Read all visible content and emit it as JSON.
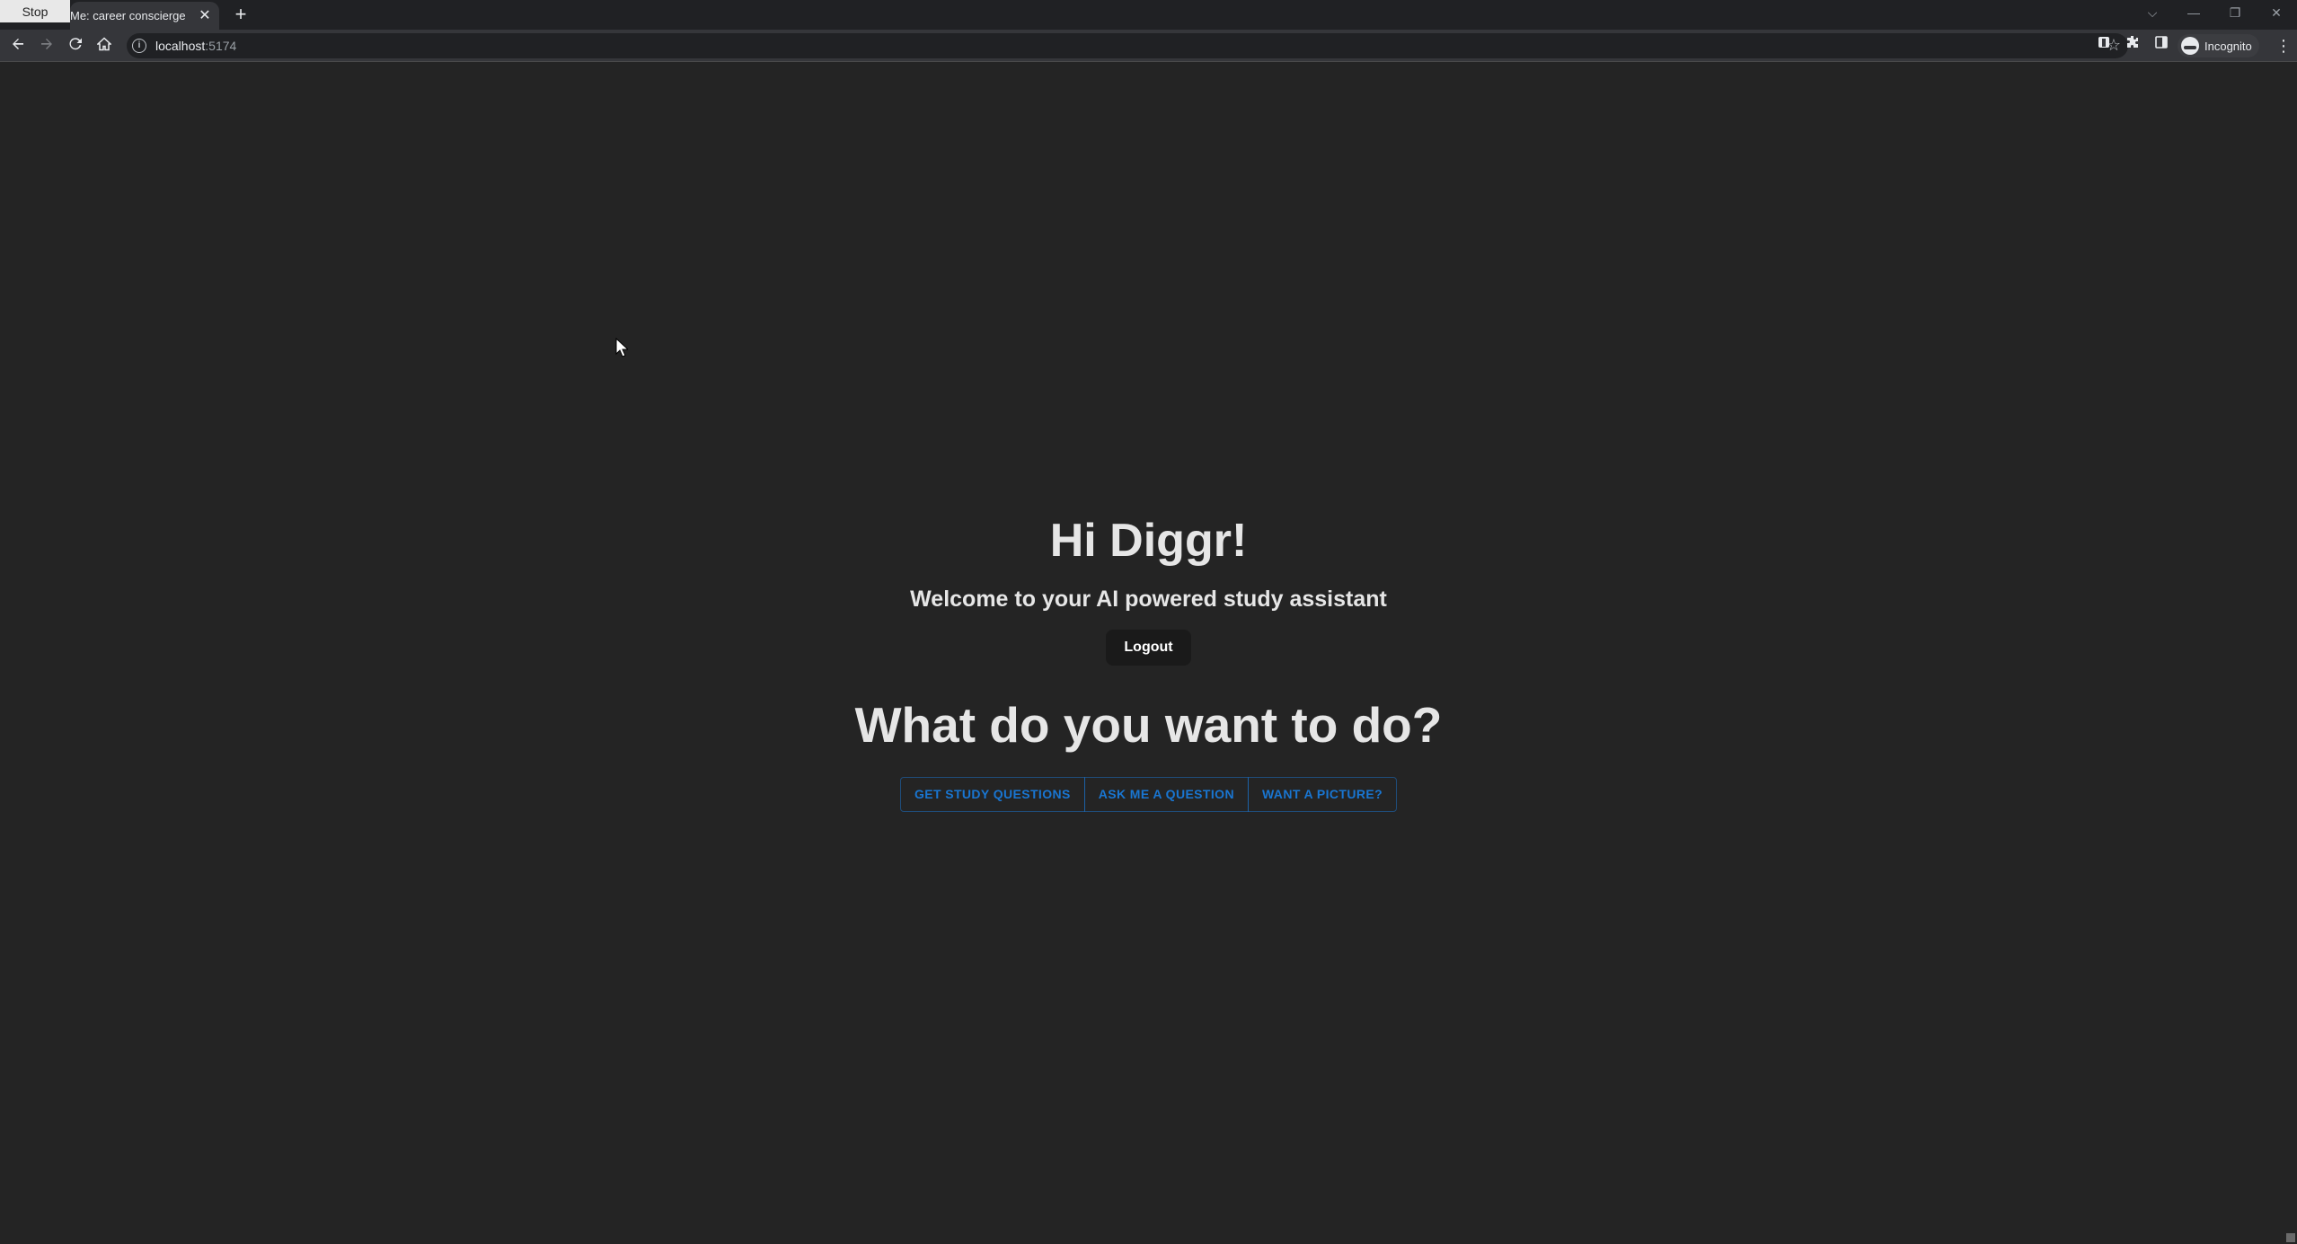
{
  "browser": {
    "stop_badge": "Stop",
    "tab_title": "Me: career conscierge",
    "tab_close": "✕",
    "new_tab": "+",
    "url_host": "localhost",
    "url_port": ":5174",
    "profile_label": "Incognito",
    "window_controls": [
      "⌵",
      "—",
      "❐",
      "✕"
    ]
  },
  "page": {
    "greeting": "Hi Diggr!",
    "welcome": "Welcome to your AI powered study assistant",
    "logout_label": "Logout",
    "question": "What do you want to do?",
    "actions": [
      {
        "label": "GET STUDY QUESTIONS"
      },
      {
        "label": "ASK ME A QUESTION"
      },
      {
        "label": "WANT A PICTURE?"
      }
    ]
  },
  "colors": {
    "page_bg": "#242424",
    "accent": "#1976d2",
    "toolbar_bg": "#35363a",
    "tabstrip_bg": "#202124"
  }
}
